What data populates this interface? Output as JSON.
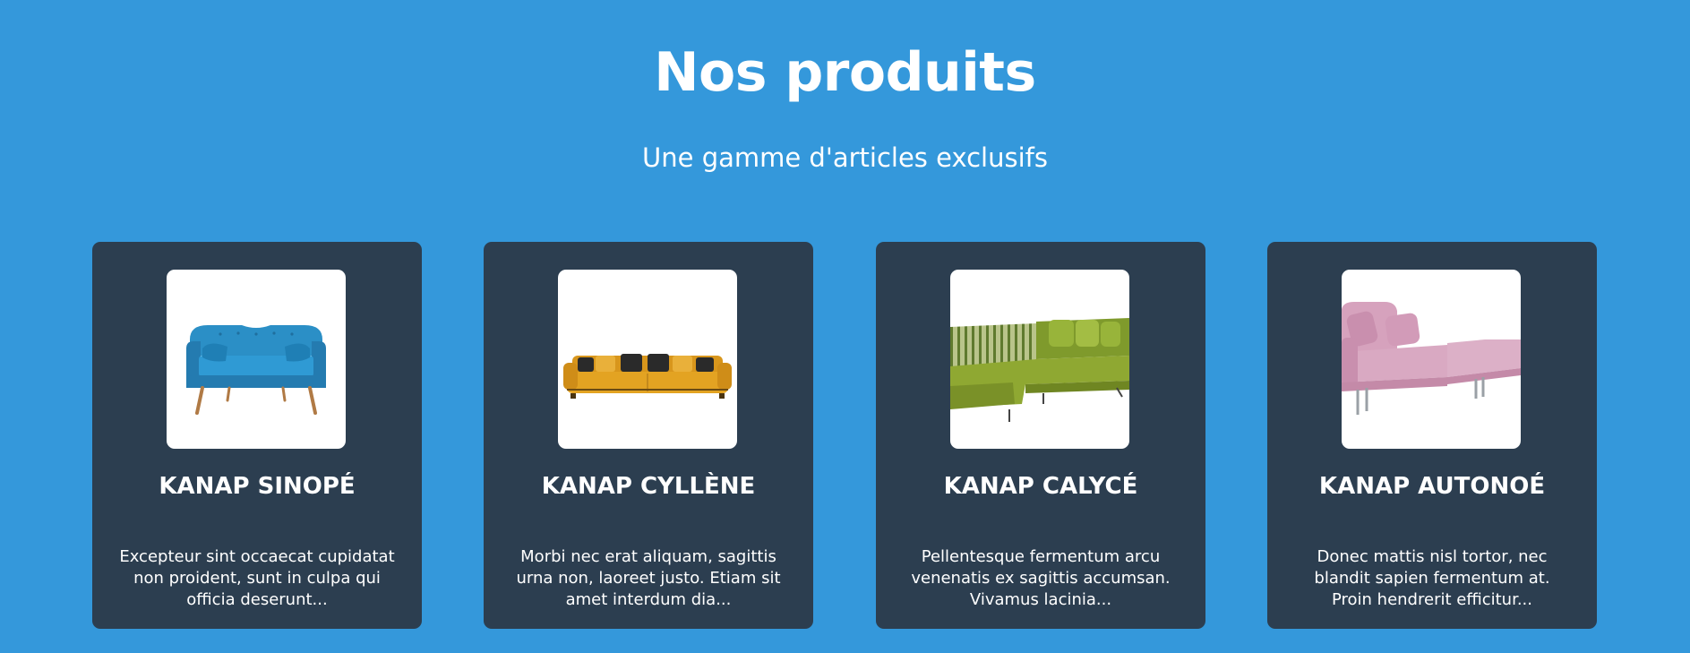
{
  "header": {
    "title": "Nos produits",
    "subtitle": "Une gamme d'articles exclusifs"
  },
  "products": [
    {
      "name": "KANAP SINOPÉ",
      "description": "Excepteur sint occaecat cupidatat non proident, sunt in culpa qui officia deserunt...",
      "image_icon": "blue-sofa-image",
      "color": "#2b8fc6"
    },
    {
      "name": "KANAP CYLLÈNE",
      "description": "Morbi nec erat aliquam, sagittis urna non, laoreet justo. Etiam sit amet interdum dia...",
      "image_icon": "yellow-sofa-image",
      "color": "#e3a322"
    },
    {
      "name": "KANAP CALYCÉ",
      "description": "Pellentesque fermentum arcu venenatis ex sagittis accumsan. Vivamus lacinia...",
      "image_icon": "green-sectional-sofa-image",
      "color": "#8fa832"
    },
    {
      "name": "KANAP AUTONOÉ",
      "description": "Donec mattis nisl tortor, nec blandit sapien fermentum at. Proin hendrerit efficitur...",
      "image_icon": "pink-sofa-image",
      "color": "#d6a2bd"
    }
  ],
  "colors": {
    "background": "#3498db",
    "card": "#2c3e50",
    "text": "#ffffff"
  }
}
